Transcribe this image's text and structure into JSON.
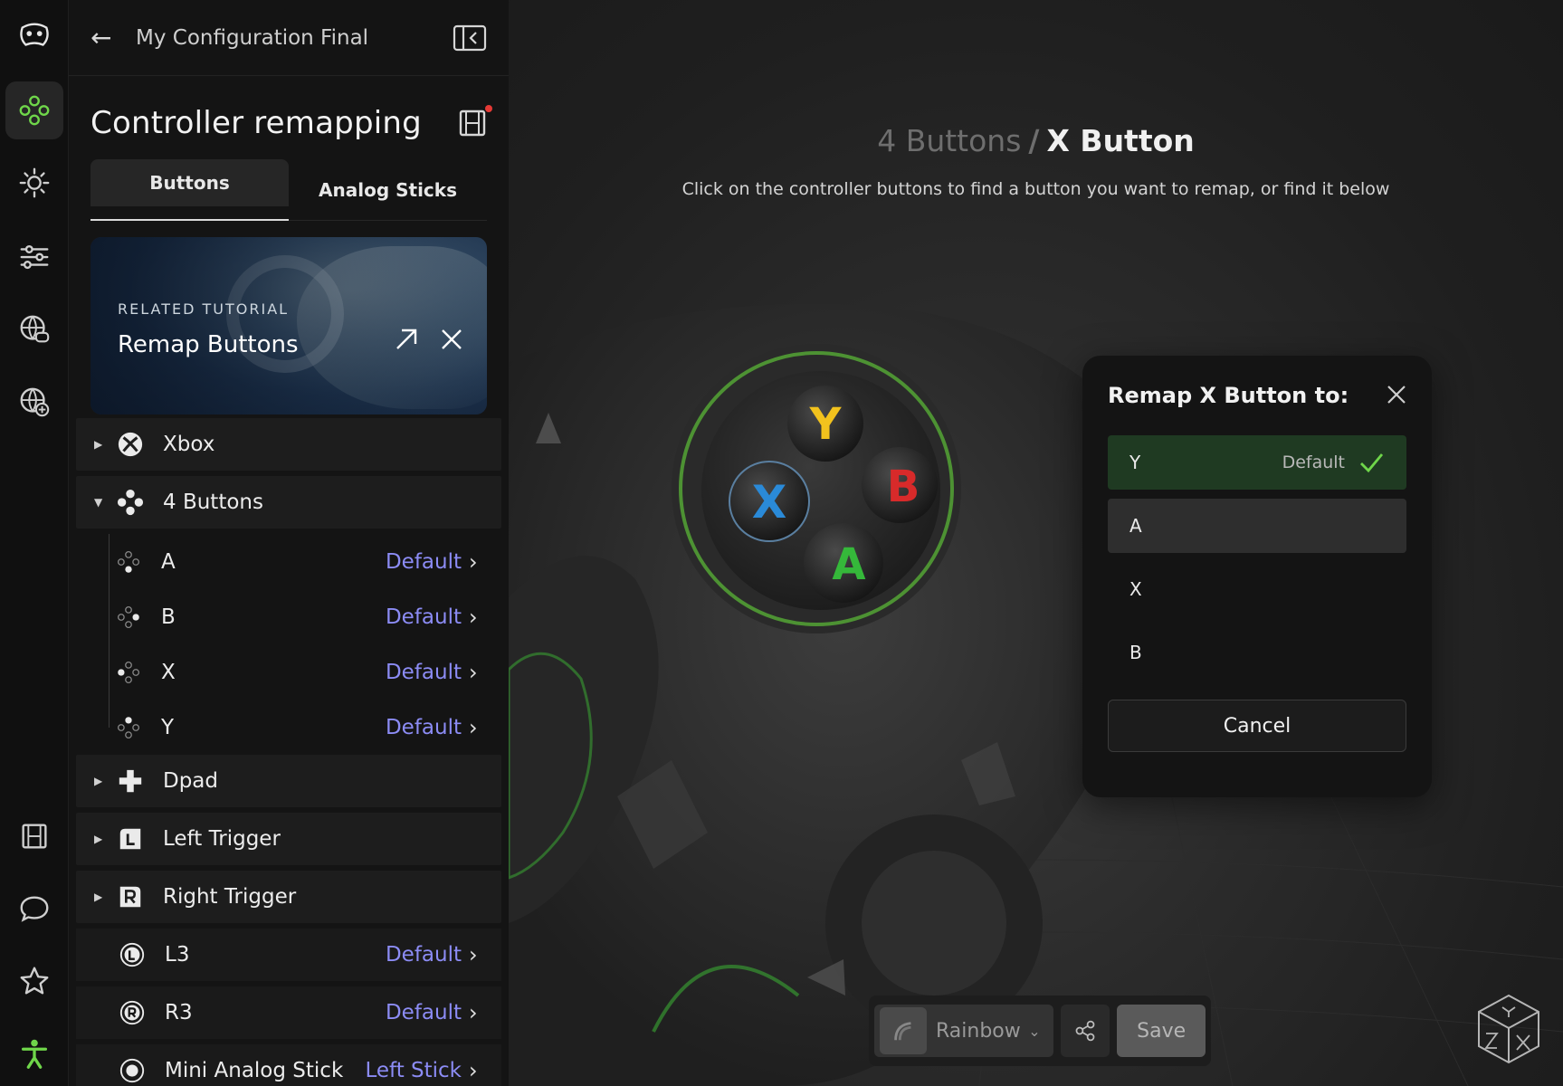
{
  "header": {
    "config_name": "My Configuration Final",
    "page_title": "Controller remapping"
  },
  "tabs": [
    {
      "label": "Buttons",
      "active": true
    },
    {
      "label": "Analog Sticks",
      "active": false
    }
  ],
  "tutorial": {
    "kicker": "RELATED TUTORIAL",
    "title": "Remap Buttons"
  },
  "tree": {
    "xbox": {
      "label": "Xbox"
    },
    "four_buttons": {
      "label": "4 Buttons",
      "children": [
        {
          "label": "A",
          "value": "Default"
        },
        {
          "label": "B",
          "value": "Default"
        },
        {
          "label": "X",
          "value": "Default"
        },
        {
          "label": "Y",
          "value": "Default"
        }
      ]
    },
    "dpad": {
      "label": "Dpad"
    },
    "left_trigger": {
      "label": "Left Trigger"
    },
    "right_trigger": {
      "label": "Right Trigger"
    },
    "l3": {
      "label": "L3",
      "value": "Default"
    },
    "r3": {
      "label": "R3",
      "value": "Default"
    },
    "mini_stick": {
      "label": "Mini Analog Stick",
      "value": "Left Stick"
    }
  },
  "stage": {
    "crumb_parent": "4 Buttons",
    "crumb_sep": "/",
    "crumb_current": "X Button",
    "hint": "Click on the controller buttons to find a button you want to remap, or find it below"
  },
  "remap": {
    "title": "Remap X Button to:",
    "options": [
      {
        "label": "Y",
        "tag": "Default",
        "checked": true
      },
      {
        "label": "A",
        "tag": "",
        "checked": false
      },
      {
        "label": "X",
        "tag": "",
        "checked": false
      },
      {
        "label": "B",
        "tag": "",
        "checked": false
      }
    ],
    "cancel": "Cancel"
  },
  "toolbar": {
    "lighting": "Rainbow",
    "save": "Save"
  },
  "face_buttons": {
    "Y": "Y",
    "X": "X",
    "B": "B",
    "A": "A"
  },
  "colors": {
    "accent_green": "#6fd64a",
    "value_blue": "#8c8cf5",
    "button_y": "#f2c21d",
    "button_x": "#2a8ad8",
    "button_b": "#d82a2a",
    "button_a": "#35b83a"
  }
}
